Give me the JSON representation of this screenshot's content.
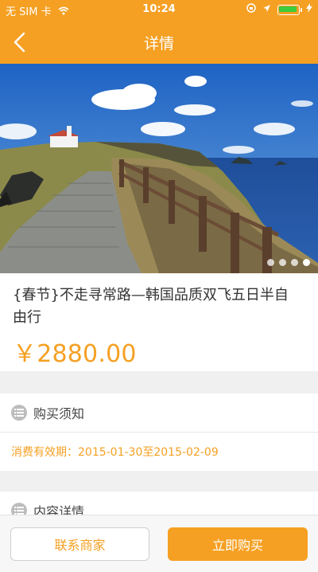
{
  "status_bar": {
    "carrier": "无 SIM 卡",
    "time": "10:24"
  },
  "nav": {
    "title": "详情",
    "back_icon": "chevron-left-icon"
  },
  "hero": {
    "slide_count": 4,
    "active_index": 3
  },
  "product": {
    "title": "{春节}不走寻常路—韩国品质双飞五日半自由行",
    "price": "￥2880.00"
  },
  "purchase_notice": {
    "header": "购买须知",
    "validity": "消费有效期：2015-01-30至2015-02-09"
  },
  "content_details": {
    "header": "内容详情"
  },
  "actions": {
    "contact": "联系商家",
    "buy": "立即购买"
  },
  "colors": {
    "accent": "#f5a023",
    "background": "#f0f0f0"
  }
}
